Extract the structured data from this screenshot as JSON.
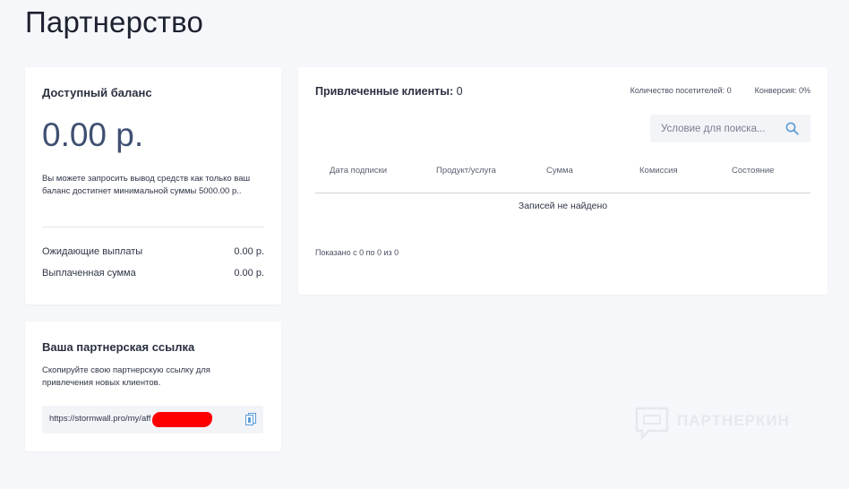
{
  "page": {
    "title": "Партнерство"
  },
  "balance": {
    "title": "Доступный баланс",
    "amount": "0.00 р.",
    "note": "Вы можете запросить вывод средств как только ваш баланс достигнет минимальной суммы 5000.00 р..",
    "pending_label": "Ожидающие выплаты",
    "pending_value": "0.00 р.",
    "paid_label": "Выплаченная сумма",
    "paid_value": "0.00 р."
  },
  "affiliate_link": {
    "title": "Ваша партнерская ссылка",
    "note": "Скопируйте свою партнерскую ссылку для привлечения новых клиентов.",
    "url": "https://stormwall.pro/my/aff",
    "copy_icon": "copy-icon"
  },
  "clients": {
    "title": "Привлеченные клиенты:",
    "count": "0",
    "visitors": "Количество посетителей: 0",
    "conversion": "Конверсия: 0%",
    "search_placeholder": "Условие для поиска...",
    "columns": [
      "Дата подписки",
      "Продукт/услуга",
      "Сумма",
      "Комиссия",
      "Состояние"
    ],
    "empty_text": "Записей не найдено",
    "footer_info": "Показано с 0 по 0 из 0"
  },
  "watermark": {
    "text": "ПАРТНЕРКИН"
  },
  "colors": {
    "background": "#f6f7fb",
    "card": "#ffffff",
    "amount": "#3f4f72",
    "search_icon": "#5b9bd5",
    "redaction": "#ff0000"
  }
}
